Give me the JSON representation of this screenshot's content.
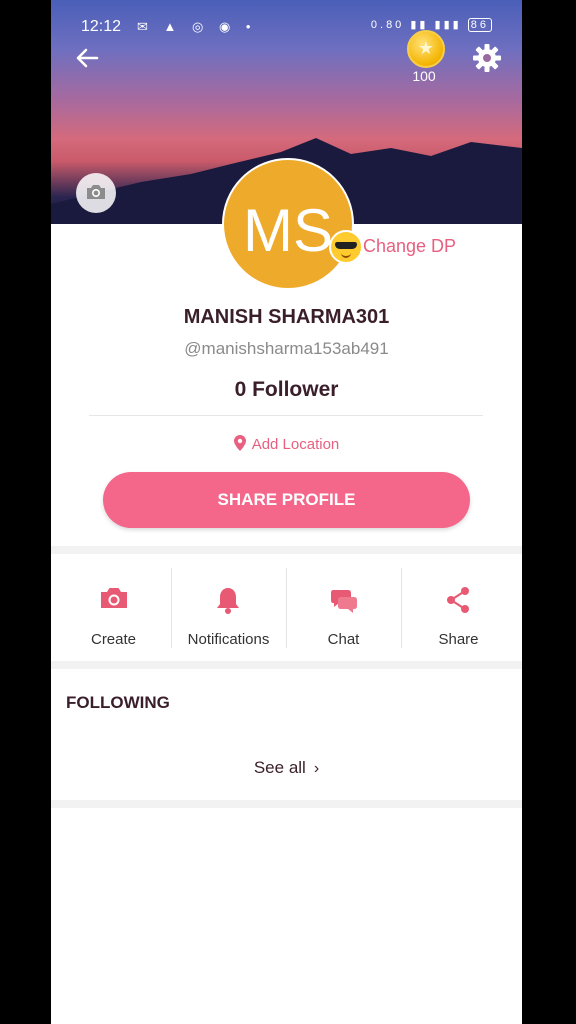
{
  "status_bar": {
    "time": "12:12",
    "battery": "86",
    "net_speed": "0.80"
  },
  "header": {
    "coin_count": "100"
  },
  "profile": {
    "initials": "MS",
    "change_dp_label": "Change DP",
    "name": "MANISH SHARMA301",
    "handle": "@manishsharma153ab491",
    "followers": "0 Follower",
    "add_location_label": "Add Location",
    "share_profile_label": "SHARE PROFILE"
  },
  "actions": [
    {
      "label": "Create",
      "icon": "camera-icon"
    },
    {
      "label": "Notifications",
      "icon": "bell-icon"
    },
    {
      "label": "Chat",
      "icon": "chat-icon"
    },
    {
      "label": "Share",
      "icon": "share-icon"
    }
  ],
  "following": {
    "title": "FOLLOWING",
    "see_all_label": "See all"
  },
  "colors": {
    "accent": "#f4668a",
    "accent_text": "#e85f7f",
    "avatar": "#eeaa2a",
    "dark_text": "#3a1f2a"
  }
}
